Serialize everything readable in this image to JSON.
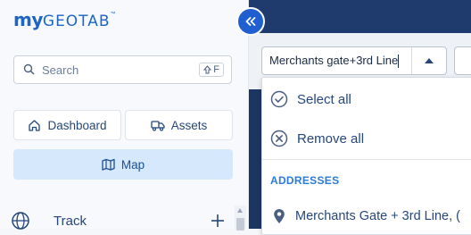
{
  "logo": {
    "my": "my",
    "geotab": "GEOTAB",
    "tm": "™"
  },
  "search": {
    "placeholder": "Search",
    "shortcut_key": "F"
  },
  "nav": {
    "dashboard": "Dashboard",
    "assets": "Assets",
    "map": "Map",
    "track": "Track"
  },
  "filter": {
    "value": "Merchants gate+3rd Line",
    "select_all": "Select all",
    "remove_all": "Remove all",
    "section": "ADDRESSES",
    "address_result": "Merchants Gate + 3rd Line, ("
  },
  "colors": {
    "brand": "#1e66c4",
    "accent": "#1f5fcf",
    "topbar": "#1f3b6e",
    "map_active": "#d6e8fb",
    "section_label": "#2b7bd8"
  },
  "icons": {
    "search": "search-icon",
    "shift": "shift-icon",
    "home": "home-icon",
    "truck": "truck-icon",
    "map": "map-icon",
    "globe": "globe-icon",
    "plus": "plus-icon",
    "collapse": "chevron-double-left-icon",
    "dropdown": "caret-up-icon",
    "check": "check-circle-icon",
    "remove": "x-circle-icon",
    "pin": "location-pin-icon"
  }
}
